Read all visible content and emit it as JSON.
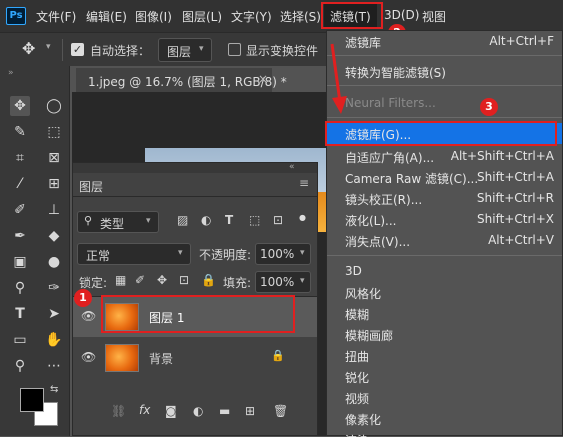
{
  "menubar": {
    "logo": "Ps",
    "items": [
      "文件(F)",
      "编辑(E)",
      "图像(I)",
      "图层(L)",
      "文字(Y)",
      "选择(S)",
      "滤镜(T)",
      "3D(D)",
      "视图"
    ]
  },
  "options": {
    "auto_select_label": "自动选择：",
    "auto_select_value": "图层",
    "show_transform_label": "显示变换控件"
  },
  "document": {
    "tab_title": "1.jpeg @ 16.7% (图层 1, RGB/8) *",
    "close": "×"
  },
  "layers_panel": {
    "title": "图层",
    "filter_type": "类型",
    "blend_mode": "正常",
    "opacity_label": "不透明度:",
    "opacity_value": "100%",
    "lock_label": "锁定:",
    "fill_label": "填充:",
    "fill_value": "100%",
    "layers": [
      {
        "name": "图层 1",
        "visible": true,
        "selected": true
      },
      {
        "name": "背景",
        "visible": true,
        "locked": true
      }
    ],
    "bottom_icons": [
      "link-icon",
      "fx-icon",
      "mask-icon",
      "adjustment-icon",
      "folder-icon",
      "new-layer-icon",
      "trash-icon"
    ],
    "fx_label": "fx"
  },
  "filter_menu": {
    "items": [
      {
        "label": "滤镜库",
        "shortcut": "Alt+Ctrl+F"
      },
      {
        "label": "转换为智能滤镜(S)",
        "shortcut": ""
      },
      {
        "label": "Neural Filters...",
        "shortcut": "",
        "disabled": true
      },
      {
        "label": "滤镜库(G)...",
        "shortcut": "",
        "highlighted": true
      },
      {
        "label": "自适应广角(A)...",
        "shortcut": "Alt+Shift+Ctrl+A"
      },
      {
        "label": "Camera Raw 滤镜(C)...",
        "shortcut": "Shift+Ctrl+A"
      },
      {
        "label": "镜头校正(R)...",
        "shortcut": "Shift+Ctrl+R"
      },
      {
        "label": "液化(L)...",
        "shortcut": "Shift+Ctrl+X"
      },
      {
        "label": "消失点(V)...",
        "shortcut": "Alt+Ctrl+V"
      },
      {
        "label": "3D",
        "shortcut": ""
      },
      {
        "label": "风格化",
        "shortcut": ""
      },
      {
        "label": "模糊",
        "shortcut": ""
      },
      {
        "label": "模糊画廊",
        "shortcut": ""
      },
      {
        "label": "扭曲",
        "shortcut": ""
      },
      {
        "label": "锐化",
        "shortcut": ""
      },
      {
        "label": "视频",
        "shortcut": ""
      },
      {
        "label": "像素化",
        "shortcut": ""
      },
      {
        "label": "渲染",
        "shortcut": ""
      }
    ]
  },
  "annotations": {
    "badge1": "1",
    "badge2": "2",
    "badge3": "3",
    "accent": "#e02020",
    "highlight": "#1473e6"
  }
}
